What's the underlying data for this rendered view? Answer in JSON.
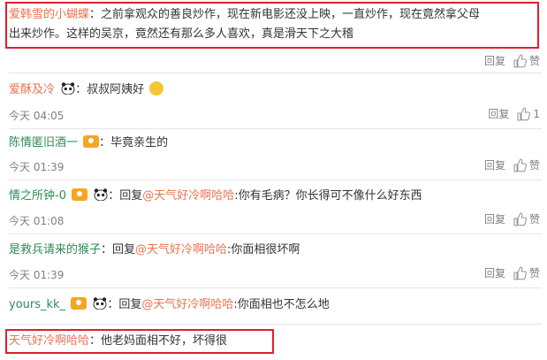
{
  "comments": [
    {
      "user": "爱韩雪的小蝴蝶",
      "text_line1": "：之前拿观众的善良炒作，现在新电影还没上映，一直炒作，现在竟然拿父母",
      "text_line2": "出来炒作。这样的吴京，竟然还有那么多人喜欢，真是滑天下之大稽",
      "reply_label": "回复",
      "like_label": "赞"
    },
    {
      "user": "爱酥及冷",
      "text": "：叔叔阿姨好",
      "time": "今天 04:05",
      "reply_label": "回复",
      "like_count": "1"
    },
    {
      "user": "陈情匿旧酒一",
      "text": "：毕竟亲生的",
      "time": "今天 01:39",
      "reply_label": "回复",
      "like_label": "赞"
    },
    {
      "user": "情之所钟-0",
      "reply_prefix": "：回复",
      "mention": "@天气好冷啊哈哈",
      "text": ":你有毛病？你长得可不像什么好东西",
      "time": "今天 01:08",
      "reply_label": "回复",
      "like_label": "赞"
    },
    {
      "user": "是救兵请来的猴子",
      "reply_prefix": "：回复",
      "mention": "@天气好冷啊哈哈",
      "text": ":你面相很坏啊",
      "time": "今天 01:39",
      "reply_label": "回复",
      "like_label": "赞"
    },
    {
      "user": "yours_kk_",
      "reply_prefix": "：回复",
      "mention": "@天气好冷啊哈哈",
      "text": ":你面相也不怎么地"
    },
    {
      "user": "天气好冷啊哈哈",
      "text": "：他老妈面相不好，坏得很"
    }
  ],
  "colors": {
    "username": "#eb7350",
    "highlight_box": "#e0202a"
  }
}
